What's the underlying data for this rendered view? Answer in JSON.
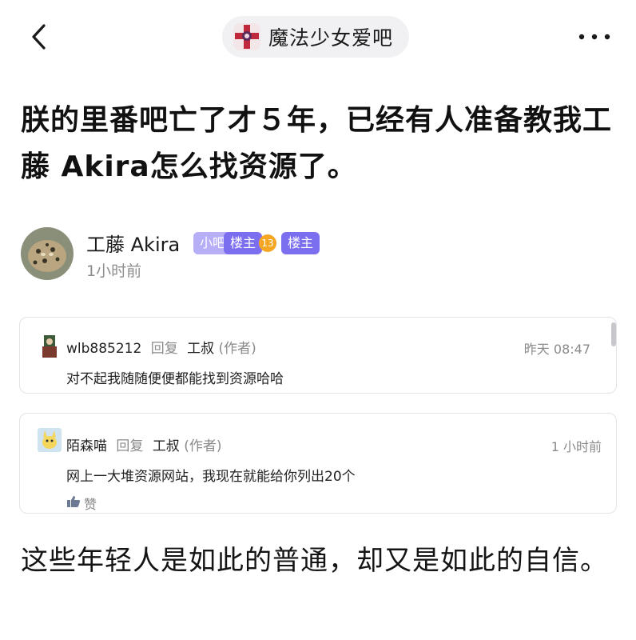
{
  "header": {
    "forum_name": "魔法少女爱吧"
  },
  "post": {
    "title": "朕的里番吧亡了才５年，已经有人准备教我工藤 Akira怎么找资源了。",
    "author": {
      "name": "工藤 Akira",
      "badge_small": "小吧",
      "badge_floor_owner": "楼主",
      "level": "13",
      "badge_owner2": "楼主",
      "time": "1小时前"
    },
    "comments": [
      {
        "user": "wlb885212",
        "reply_label": "回复",
        "reply_to": "工叔",
        "author_tag": "(作者)",
        "time": "昨天 08:47",
        "text": "对不起我随随便便都能找到资源哈哈"
      },
      {
        "user": "陌森喵",
        "reply_label": "回复",
        "reply_to": "工叔",
        "author_tag": "(作者)",
        "time": "1 小时前",
        "text": "网上一大堆资源网站，我现在就能给你列出20个",
        "like_label": "赞"
      }
    ],
    "body": "这些年轻人是如此的普通，却又是如此的自信。"
  },
  "colors": {
    "badge_purple": "#7b6ff0",
    "level_orange": "#f5a623",
    "pill_bg": "#f1f1f4"
  }
}
